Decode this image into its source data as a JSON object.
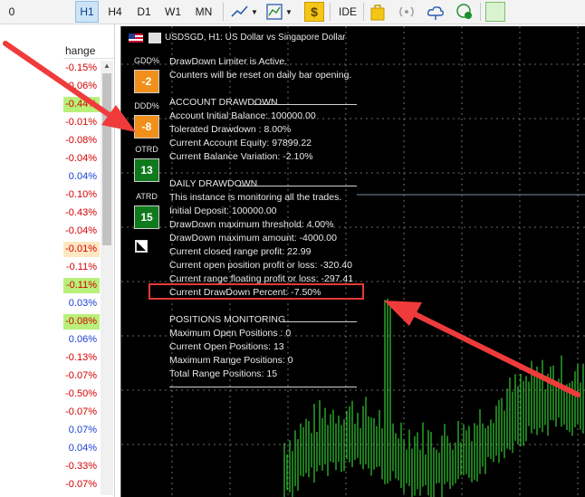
{
  "toolbar": {
    "timeframes": [
      "0",
      "H1",
      "H4",
      "D1",
      "W1",
      "MN"
    ],
    "active_timeframe": "H1",
    "ide_label": "IDE",
    "icons": [
      "line-chart-icon",
      "indicator-chart-icon",
      "dollar-icon",
      "bag-icon",
      "signal-icon",
      "cloud-icon",
      "globe-icon"
    ]
  },
  "market_watch": {
    "header": "hange",
    "rows": [
      {
        "value": "-0.15%",
        "sign": "neg",
        "hl": ""
      },
      {
        "value": "-0.06%",
        "sign": "neg",
        "hl": ""
      },
      {
        "value": "-0.44%",
        "sign": "neg",
        "hl": "hl"
      },
      {
        "value": "-0.01%",
        "sign": "neg",
        "hl": ""
      },
      {
        "value": "-0.08%",
        "sign": "neg",
        "hl": ""
      },
      {
        "value": "-0.04%",
        "sign": "neg",
        "hl": ""
      },
      {
        "value": "0.04%",
        "sign": "pos",
        "hl": ""
      },
      {
        "value": "-0.10%",
        "sign": "neg",
        "hl": ""
      },
      {
        "value": "-0.43%",
        "sign": "neg",
        "hl": ""
      },
      {
        "value": "-0.04%",
        "sign": "neg",
        "hl": ""
      },
      {
        "value": "-0.01%",
        "sign": "neg",
        "hl": "hl2"
      },
      {
        "value": "-0.11%",
        "sign": "neg",
        "hl": ""
      },
      {
        "value": "-0.11%",
        "sign": "neg",
        "hl": "hl"
      },
      {
        "value": "0.03%",
        "sign": "pos",
        "hl": ""
      },
      {
        "value": "-0.08%",
        "sign": "neg",
        "hl": "hl"
      },
      {
        "value": "0.06%",
        "sign": "pos",
        "hl": ""
      },
      {
        "value": "-0.13%",
        "sign": "neg",
        "hl": ""
      },
      {
        "value": "-0.07%",
        "sign": "neg",
        "hl": ""
      },
      {
        "value": "-0.50%",
        "sign": "neg",
        "hl": ""
      },
      {
        "value": "-0.07%",
        "sign": "neg",
        "hl": ""
      },
      {
        "value": "0.07%",
        "sign": "pos",
        "hl": ""
      },
      {
        "value": "0.04%",
        "sign": "pos",
        "hl": ""
      },
      {
        "value": "-0.33%",
        "sign": "neg",
        "hl": ""
      },
      {
        "value": "-0.07%",
        "sign": "neg",
        "hl": ""
      }
    ]
  },
  "chart": {
    "title": "USDSGD, H1:  US Dollar vs Singapore Dollar",
    "badges": [
      {
        "label": "GDD%",
        "value": "-2",
        "color": "orange"
      },
      {
        "label": "DDD%",
        "value": "-8",
        "color": "orange"
      },
      {
        "label": "OTRD",
        "value": "13",
        "color": "green"
      },
      {
        "label": "ATRD",
        "value": "15",
        "color": "green"
      }
    ],
    "lines": [
      "DrawDown Limiter is Active.",
      "Counters will be reset on daily bar opening.",
      "ACCOUNT DRAWDOWN",
      "Account Initial Balance: 100000.00",
      "Tolerated Drawdown : 8.00%",
      "Current Account Equity: 97899.22",
      "Current Balance Variation: -2.10%",
      "DAILY DRAWDOWN",
      "This instance is monitoring all the trades.",
      "Initial Deposit: 100000.00",
      "DrawDown maximum threshold: 4.00%",
      "DrawDown maximum amount: -4000.00",
      "Current closed range profit: 22.99",
      "Current open position profit or loss: -320.40",
      "Current range floating profit or loss: -297.41",
      "Current DrawDown Percent: -7.50%",
      "POSITIONS MONITORING",
      "Maximum Open Positions : 0",
      "Current Open Positions: 13",
      "Maximum Range Positions: 0",
      "Total Range Positions: 15"
    ],
    "colors": {
      "orange": "#f0901a",
      "green": "#0f7a1c",
      "candle": "#33cc33",
      "highlight": "#e53935"
    }
  }
}
